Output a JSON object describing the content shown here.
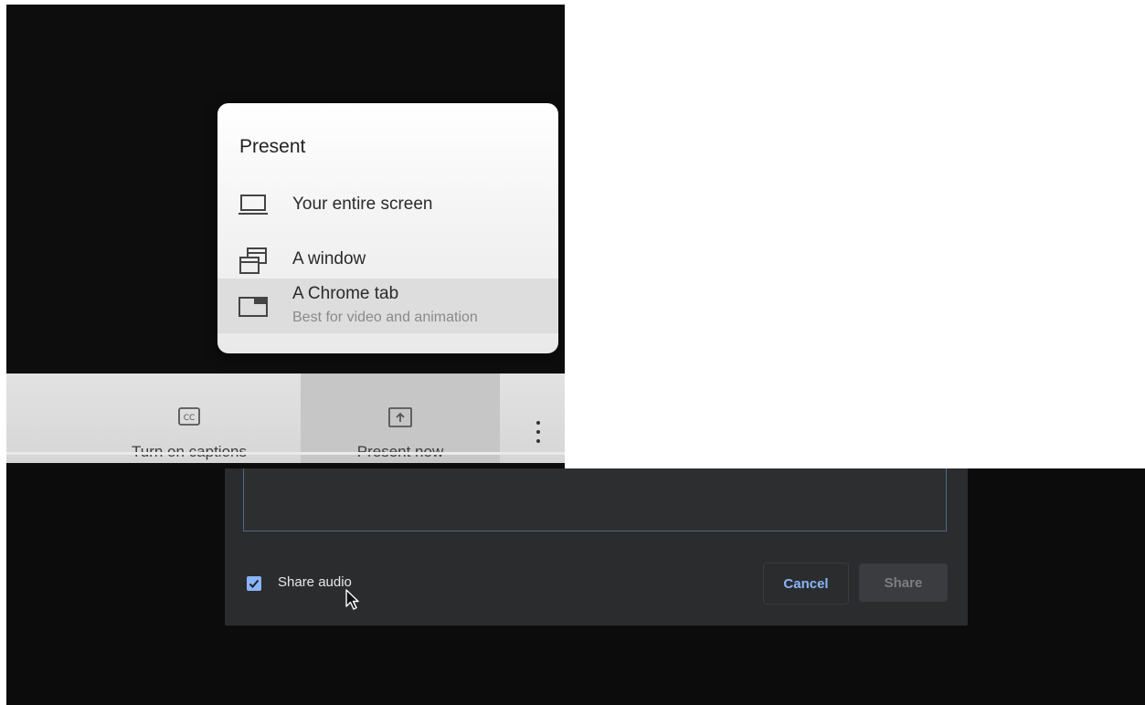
{
  "present_menu": {
    "title": "Present",
    "items": [
      {
        "label": "Your entire screen",
        "icon": "laptop-icon"
      },
      {
        "label": "A window",
        "icon": "window-icon"
      },
      {
        "label": "A Chrome tab",
        "sublabel": "Best for video and animation",
        "icon": "chrome-tab-icon"
      }
    ]
  },
  "meet_bar": {
    "captions_label": "Turn on captions",
    "captions_icon": "closed-captions-icon",
    "present_label": "Present now",
    "present_icon": "present-screen-icon",
    "more_icon": "more-vertical-icon"
  },
  "share_dialog": {
    "share_audio_label": "Share audio",
    "share_audio_checked": true,
    "cancel_label": "Cancel",
    "share_label": "Share"
  },
  "colors": {
    "accent_blue": "#8ab4f8",
    "dialog_bg": "#2b2c2e"
  }
}
